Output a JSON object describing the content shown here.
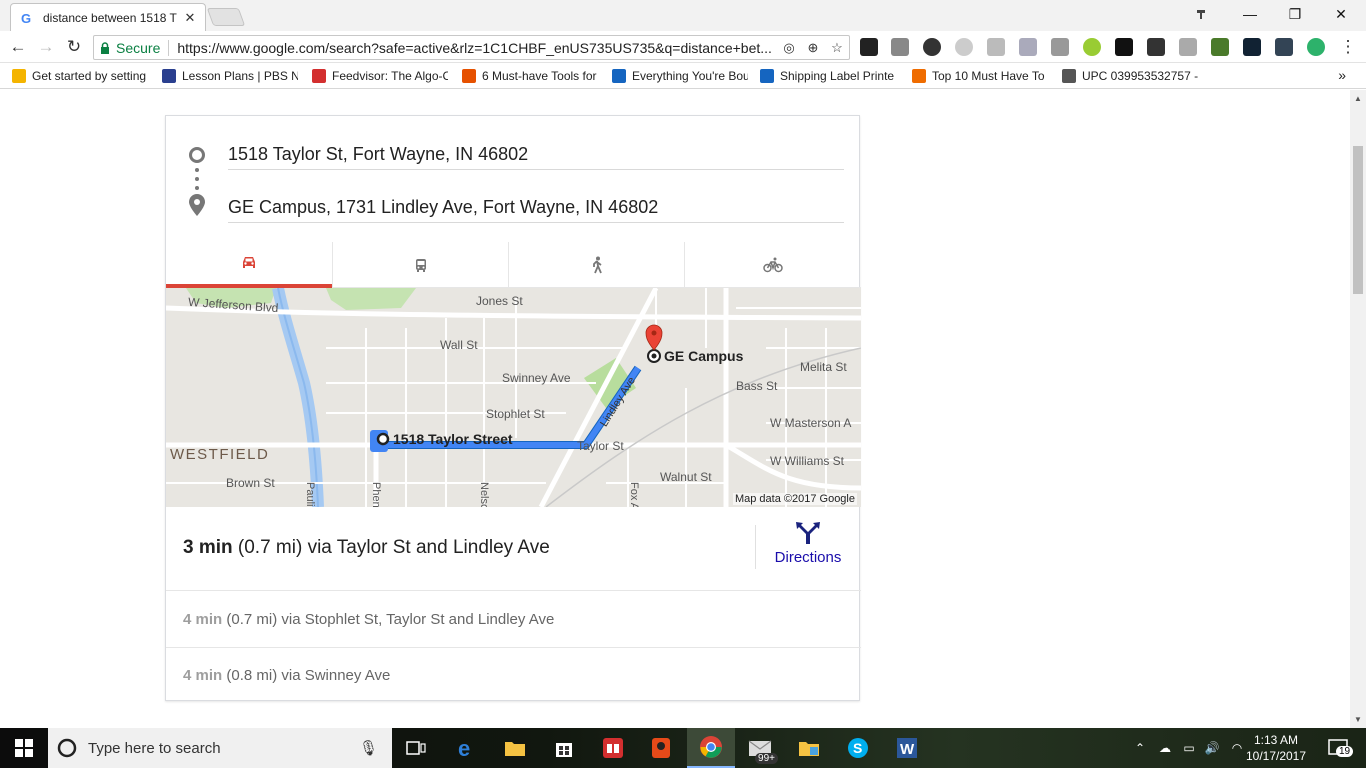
{
  "browser": {
    "tab_title": "distance between 1518 T",
    "secure_label": "Secure",
    "url": "https://www.google.com/search?safe=active&rlz=1C1CHBF_enUS735US735&q=distance+bet..."
  },
  "bookmarks": [
    {
      "label": "Get started by setting",
      "color": "#f4b400"
    },
    {
      "label": "Lesson Plans | PBS Ne",
      "color": "#2a3f8f"
    },
    {
      "label": "Feedvisor: The Algo-C",
      "color": "#d32f2f"
    },
    {
      "label": "6 Must-have Tools for",
      "color": "#e65100"
    },
    {
      "label": "Everything You're Bou",
      "color": "#1565c0"
    },
    {
      "label": "Shipping Label Printe",
      "color": "#1565c0"
    },
    {
      "label": "Top 10 Must Have To",
      "color": "#ef6c00"
    },
    {
      "label": "UPC 039953532757 -",
      "color": "#555555"
    }
  ],
  "directions": {
    "origin": "1518 Taylor St, Fort Wayne, IN 46802",
    "destination": "GE Campus, 1731 Lindley Ave, Fort Wayne, IN 46802",
    "modes": [
      "driving-icon",
      "transit-icon",
      "walking-icon",
      "cycling-icon"
    ],
    "main_route": {
      "time": "3 min",
      "detail": " (0.7 mi) via Taylor St and Lindley Ave"
    },
    "directions_label": "Directions",
    "alt_routes": [
      {
        "time": "4 min",
        "detail": " (0.7 mi) via Stophlet St, Taylor St and Lindley Ave"
      },
      {
        "time": "4 min",
        "detail": " (0.8 mi) via Swinney Ave"
      }
    ]
  },
  "map": {
    "streets": {
      "jefferson": "W Jefferson Blvd",
      "jones": "Jones St",
      "wall": "Wall St",
      "swinney": "Swinney Ave",
      "stophlet": "Stophlet St",
      "melita": "Melita St",
      "bass": "Bass St",
      "masterson": "W Masterson A",
      "williams": "W Williams St",
      "taylor": "Taylor St",
      "walnut": "Walnut St",
      "brown": "Brown St",
      "pauline": "Pauline S",
      "phenie": "Phenie S",
      "nelson": "Nelson S",
      "fox": "Fox Ave",
      "lindley": "Lindley Ave"
    },
    "neighborhood": "WESTFIELD",
    "origin_label": "1518 Taylor Street",
    "destination_label": "GE Campus",
    "attribution": "Map data ©2017 Google",
    "route_color": "#4285f4"
  },
  "taskbar": {
    "search_placeholder": "Type here to search",
    "time": "1:13 AM",
    "date": "10/17/2017",
    "notification_count": "19",
    "mail_badge": "99+"
  }
}
